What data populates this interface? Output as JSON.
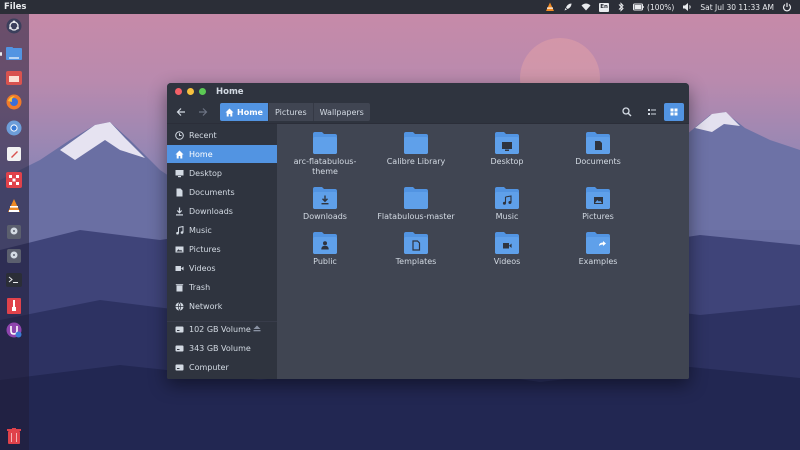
{
  "top_panel": {
    "app_name": "Files",
    "battery": "(100%)",
    "datetime": "Sat Jul 30 11:33 AM",
    "keyboard_layout": "En"
  },
  "launcher": {
    "items": [
      "dash",
      "files",
      "firefox",
      "chromium",
      "text-editor",
      "app-grid",
      "vlc",
      "disk-1",
      "disk-2",
      "terminal",
      "archive",
      "unity-tweak",
      "trash"
    ]
  },
  "window": {
    "title": "Home",
    "path": [
      {
        "label": "Home",
        "active": true
      },
      {
        "label": "Pictures",
        "active": false
      },
      {
        "label": "Wallpapers",
        "active": false
      }
    ],
    "sidebar": [
      {
        "label": "Recent",
        "icon": "clock-icon"
      },
      {
        "label": "Home",
        "icon": "home-icon",
        "selected": true
      },
      {
        "label": "Desktop",
        "icon": "desktop-icon"
      },
      {
        "label": "Documents",
        "icon": "document-icon"
      },
      {
        "label": "Downloads",
        "icon": "download-icon"
      },
      {
        "label": "Music",
        "icon": "music-icon"
      },
      {
        "label": "Pictures",
        "icon": "picture-icon"
      },
      {
        "label": "Videos",
        "icon": "video-icon"
      },
      {
        "label": "Trash",
        "icon": "trash-icon"
      },
      {
        "label": "Network",
        "icon": "network-icon"
      },
      {
        "label": "102 GB Volume",
        "icon": "drive-icon",
        "eject": true
      },
      {
        "label": "343 GB Volume",
        "icon": "drive-icon"
      },
      {
        "label": "Computer",
        "icon": "computer-icon"
      }
    ],
    "files": [
      {
        "label": "arc-flatabulous-theme",
        "emblem": "none"
      },
      {
        "label": "Calibre Library",
        "emblem": "none"
      },
      {
        "label": "Desktop",
        "emblem": "desktop"
      },
      {
        "label": "Documents",
        "emblem": "document"
      },
      {
        "label": "Downloads",
        "emblem": "download"
      },
      {
        "label": "Flatabulous-master",
        "emblem": "none"
      },
      {
        "label": "Music",
        "emblem": "music"
      },
      {
        "label": "Pictures",
        "emblem": "picture"
      },
      {
        "label": "Public",
        "emblem": "public"
      },
      {
        "label": "Templates",
        "emblem": "template"
      },
      {
        "label": "Videos",
        "emblem": "video"
      },
      {
        "label": "Examples",
        "emblem": "link"
      }
    ]
  },
  "colors": {
    "accent": "#5294e2",
    "window_bg": "#404552",
    "sidebar_bg": "#2f343f",
    "folder": "#5294e2"
  }
}
